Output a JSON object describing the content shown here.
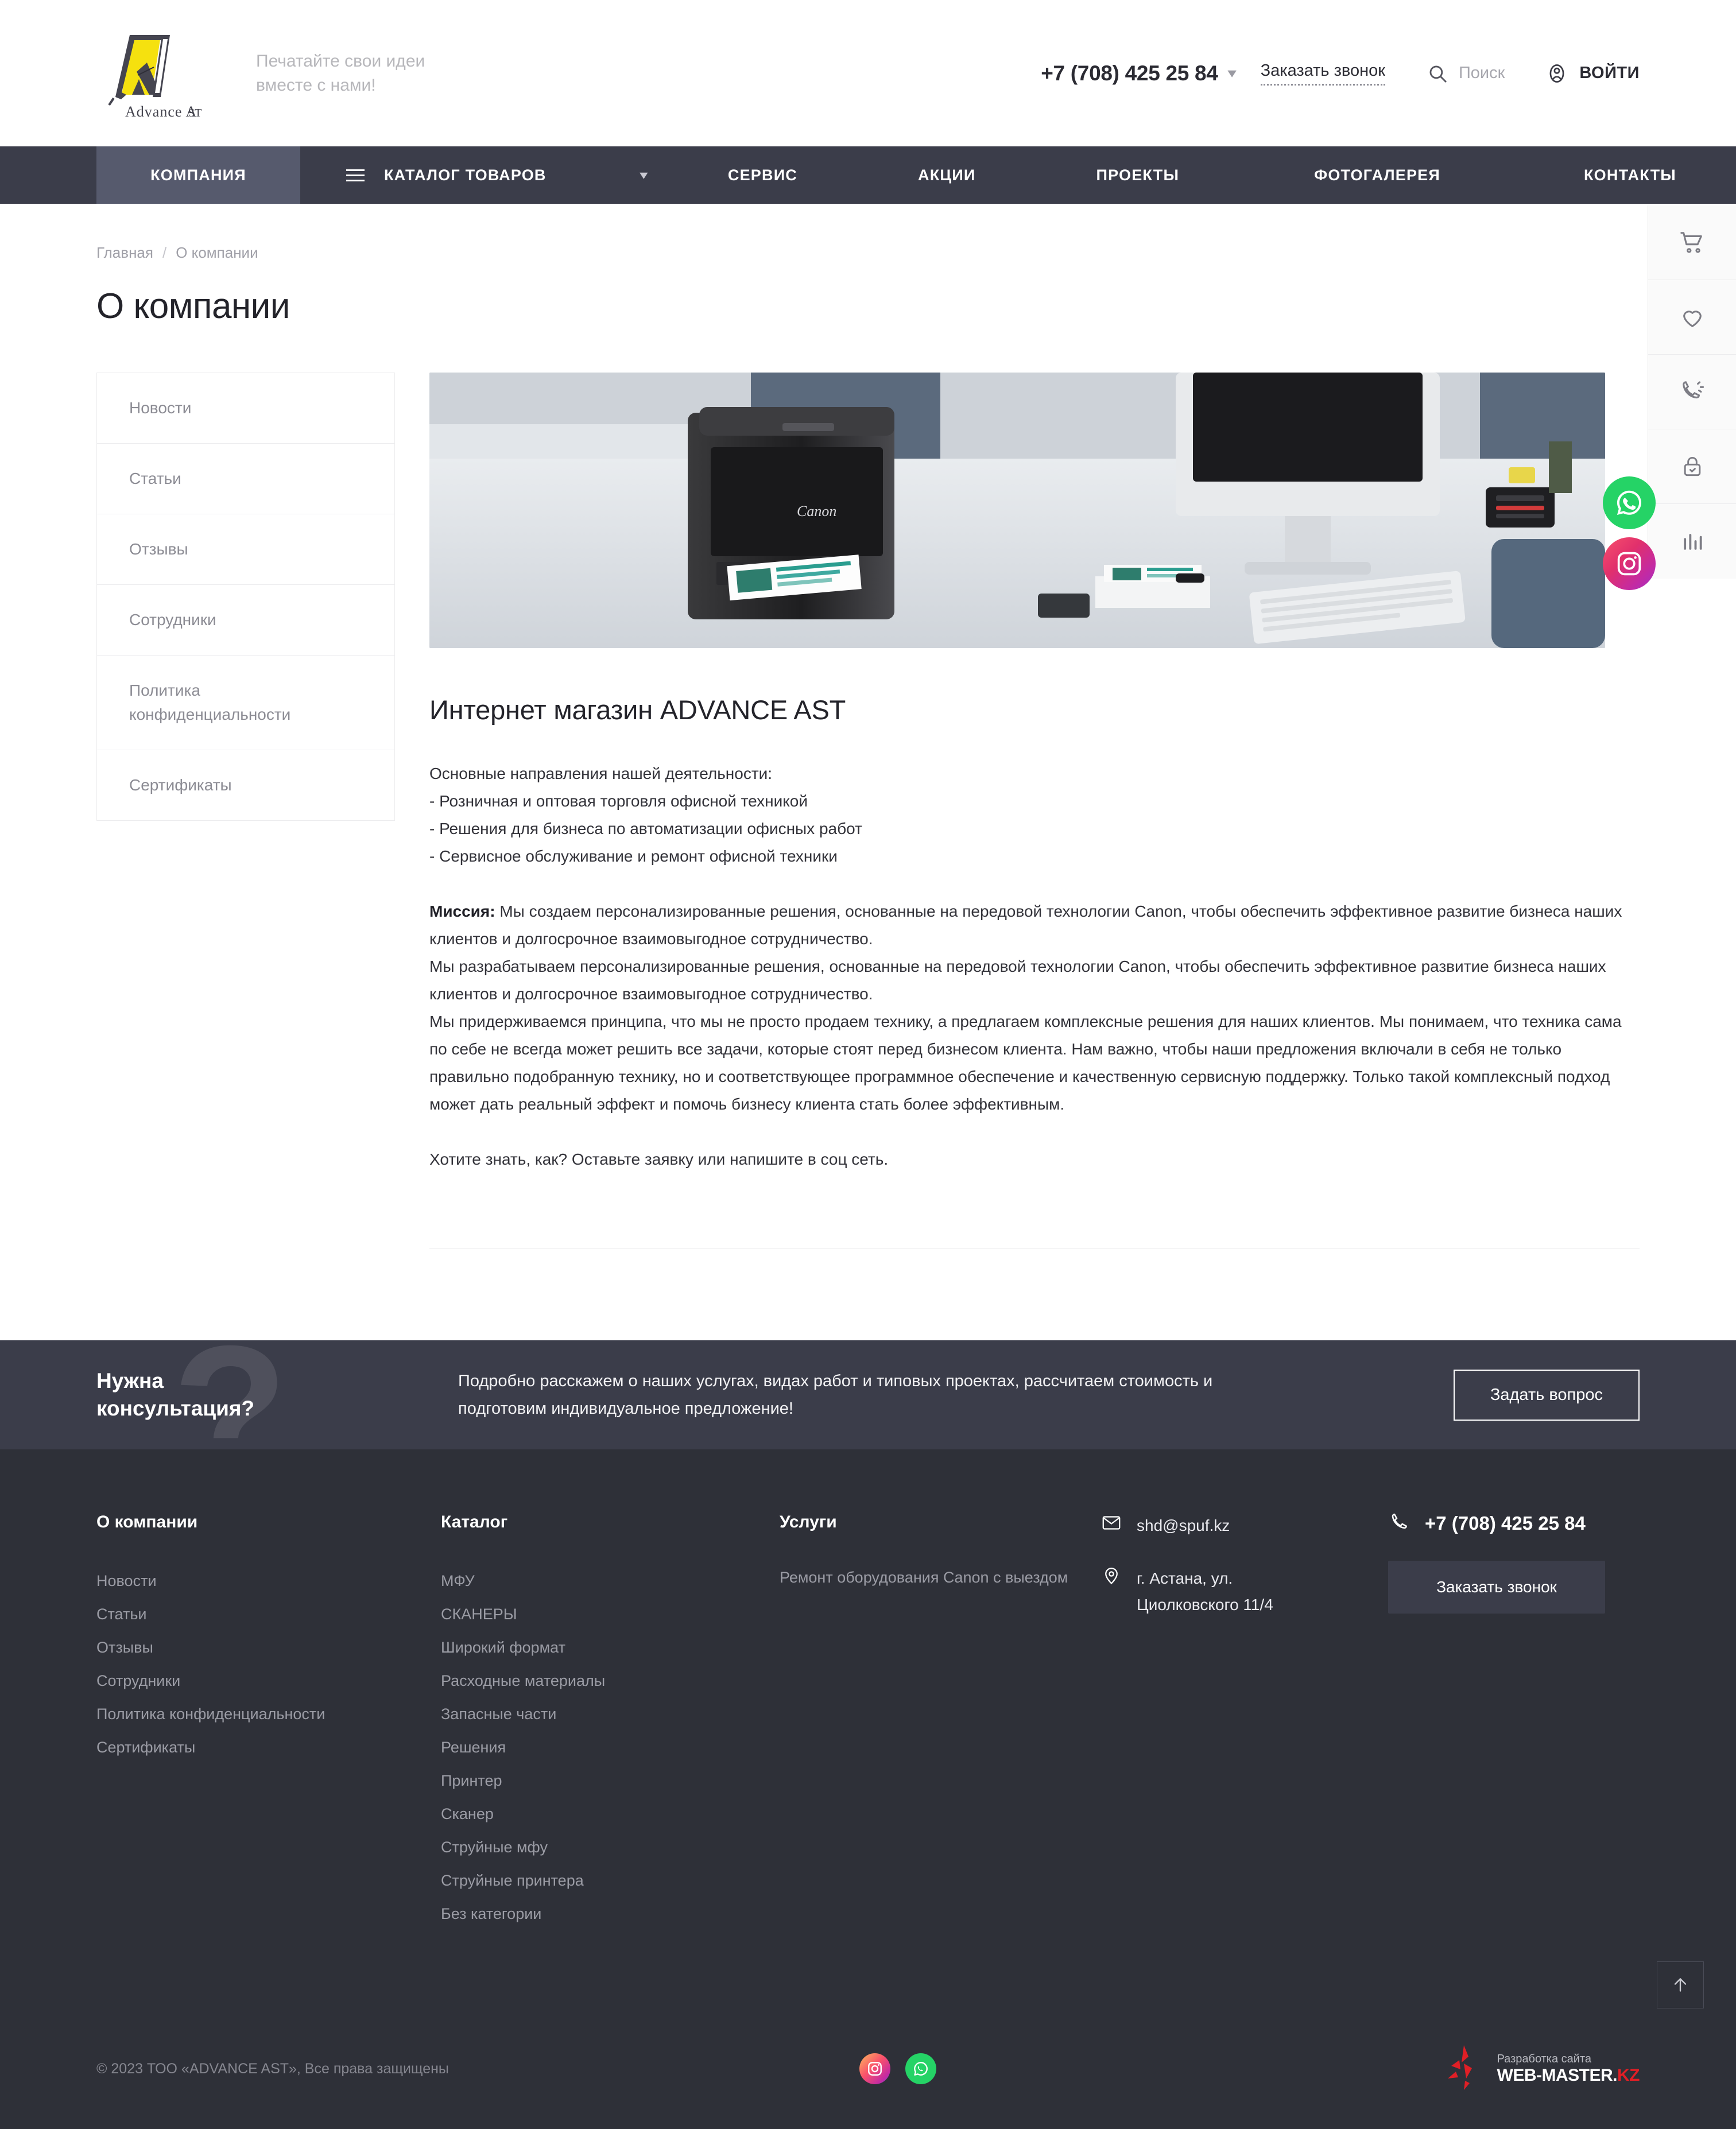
{
  "header": {
    "logo_name": "Advance Ast",
    "logo_text": "Advance Ast",
    "tagline": "Печатайте свои идеи\nвместе с нами!",
    "phone": "+7 (708) 425 25 84",
    "callback_label": "Заказать звонок",
    "search_label": "Поиск",
    "login_label": "ВОЙТИ"
  },
  "nav": {
    "items": [
      {
        "label": "КОМПАНИЯ"
      },
      {
        "label": "КАТАЛОГ ТОВАРОВ"
      },
      {
        "label": "СЕРВИС"
      },
      {
        "label": "АКЦИИ"
      },
      {
        "label": "ПРОЕКТЫ"
      },
      {
        "label": "ФОТОГАЛЕРЕЯ"
      },
      {
        "label": "КОНТАКТЫ"
      }
    ]
  },
  "side_toolbar": {
    "items": [
      {
        "icon": "cart-icon",
        "name": "cart"
      },
      {
        "icon": "heart-icon",
        "name": "favorites"
      },
      {
        "icon": "phone-ring-icon",
        "name": "callback"
      },
      {
        "icon": "lock-check-icon",
        "name": "secure"
      },
      {
        "icon": "bar-chart-icon",
        "name": "compare"
      }
    ]
  },
  "float_social": {
    "whatsapp": "whatsapp-icon",
    "instagram": "instagram-icon"
  },
  "breadcrumb": {
    "home": "Главная",
    "separator": "/",
    "current": "О компании"
  },
  "page": {
    "title": "О компании"
  },
  "sidebar": {
    "items": [
      {
        "label": "Новости"
      },
      {
        "label": "Статьи"
      },
      {
        "label": "Отзывы"
      },
      {
        "label": "Сотрудники"
      },
      {
        "label": "Политика конфиденциальности"
      },
      {
        "label": "Сертификаты"
      }
    ]
  },
  "article": {
    "hero_alt": "Canon принтер на офисном столе",
    "title": "Интернет магазин ADVANCE AST",
    "intro_heading": "Основные направления нашей деятельности:",
    "directions": [
      "- Розничная и оптовая торговля офисной техникой",
      "- Решения для бизнеса по автоматизации офисных работ",
      "- Сервисное обслуживание и ремонт офисной техники"
    ],
    "mission_label": "Миссия:",
    "mission_text": " Мы создаем персонализированные решения, основанные на передовой технологии Canon, чтобы обеспечить эффективное развитие бизнеса наших клиентов и долгосрочное взаимовыгодное сотрудничество.",
    "paragraph_2": "Мы разрабатываем персонализированные решения, основанные на передовой технологии Canon, чтобы обеспечить эффективное развитие бизнеса наших клиентов и долгосрочное взаимовыгодное сотрудничество.",
    "paragraph_3": "Мы придерживаемся принципа, что мы не просто продаем технику, а предлагаем комплексные решения для наших клиентов. Мы понимаем, что техника сама по себе не всегда может решить все задачи, которые стоят перед бизнесом клиента. Нам важно, чтобы наши предложения включали в себя не только правильно подобранную технику, но и соответствующее программное обеспечение и качественную сервисную поддержку. Только такой комплексный подход может дать реальный эффект и помочь бизнесу клиента стать более эффективным.",
    "closing": "Хотите знать, как?  Оставьте заявку или напишите в соц сеть."
  },
  "consult": {
    "title": "Нужна\nконсультация?",
    "text": "Подробно расскажем о наших услугах, видах работ и типовых проектах, рассчитаем стоимость и\nподготовим индивидуальное предложение!",
    "button": "Задать вопрос",
    "decor_mark": "?"
  },
  "footer": {
    "col_company": {
      "heading": "О компании",
      "links": [
        "Новости",
        "Статьи",
        "Отзывы",
        "Сотрудники",
        "Политика конфиденциальности",
        "Сертификаты"
      ]
    },
    "col_catalog": {
      "heading": "Каталог",
      "links": [
        "МФУ",
        "СКАНЕРЫ",
        "Широкий формат",
        "Расходные материалы",
        "Запасные части",
        "Решения",
        "Принтер",
        "Сканер",
        "Струйные мфу",
        "Струйные принтера",
        "Без категории"
      ]
    },
    "col_services": {
      "heading": "Услуги",
      "links": [
        "Ремонт оборудования Canon с выездом"
      ]
    },
    "contacts": {
      "email": "shd@spuf.kz",
      "address": "г. Астана, ул. Циолковского 11/4",
      "phone": "+7 (708) 425 25 84",
      "callback_button": "Заказать звонок"
    },
    "bottom": {
      "copyright": "© 2023 ТОО «ADVANCE AST», Все права защищены",
      "social": [
        "instagram-icon",
        "whatsapp-icon"
      ],
      "webmaster_top": "Разработка сайта",
      "webmaster_name": "WEB-MASTER.",
      "webmaster_tld": "KZ"
    }
  },
  "colors": {
    "nav_bg": "#3b3d4a",
    "nav_active": "#565a6d",
    "footer_bg": "#2e3038",
    "accent_yellow": "#f5e10f",
    "whatsapp": "#25d366",
    "red": "#e01f26"
  }
}
